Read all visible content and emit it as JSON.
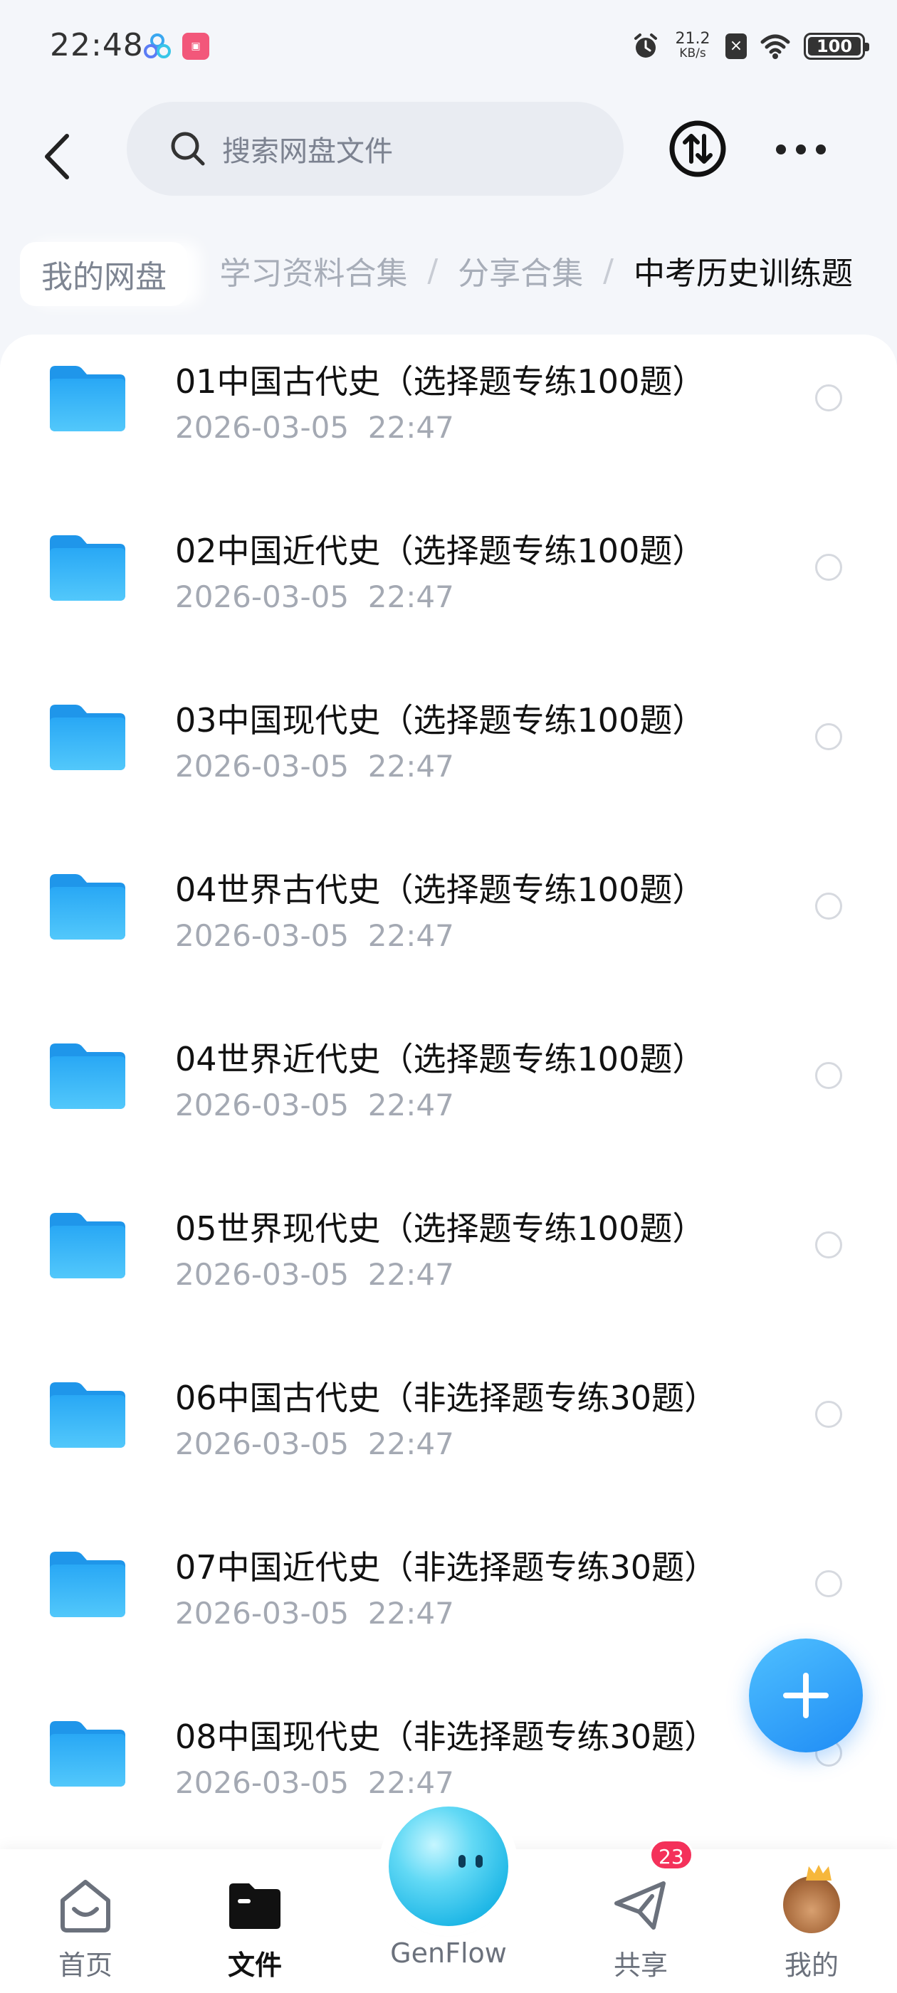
{
  "status_bar": {
    "time": "22:48",
    "net_speed_value": "21.2",
    "net_speed_unit": "KB/s",
    "battery": "100"
  },
  "header": {
    "search_placeholder": "搜索网盘文件"
  },
  "breadcrumb": {
    "root": "我的网盘",
    "trail": [
      "学习资料合集",
      "分享合集"
    ],
    "separator": "/",
    "current": "中考历史训练题"
  },
  "files": [
    {
      "name": "01中国古代史（选择题专练100题）",
      "date": "2026-03-05",
      "time": "22:47"
    },
    {
      "name": "02中国近代史（选择题专练100题）",
      "date": "2026-03-05",
      "time": "22:47"
    },
    {
      "name": "03中国现代史（选择题专练100题）",
      "date": "2026-03-05",
      "time": "22:47"
    },
    {
      "name": "04世界古代史（选择题专练100题）",
      "date": "2026-03-05",
      "time": "22:47"
    },
    {
      "name": "04世界近代史（选择题专练100题）",
      "date": "2026-03-05",
      "time": "22:47"
    },
    {
      "name": "05世界现代史（选择题专练100题）",
      "date": "2026-03-05",
      "time": "22:47"
    },
    {
      "name": "06中国古代史（非选择题专练30题）",
      "date": "2026-03-05",
      "time": "22:47"
    },
    {
      "name": "07中国近代史（非选择题专练30题）",
      "date": "2026-03-05",
      "time": "22:47"
    },
    {
      "name": "08中国现代史（非选择题专练30题）",
      "date": "2026-03-05",
      "time": "22:47"
    }
  ],
  "bottom_nav": {
    "home": "首页",
    "files": "文件",
    "genflow": "GenFlow",
    "share": "共享",
    "share_badge": "23",
    "mine": "我的"
  },
  "colors": {
    "accent": "#1f8cf5",
    "folder": "#3db4f7",
    "badge": "#f4315a"
  },
  "icons": {
    "back": "back-arrow-icon",
    "search": "search-icon",
    "transfer": "transfer-icon",
    "more": "more-icon",
    "folder": "folder-icon",
    "add": "plus-icon"
  }
}
